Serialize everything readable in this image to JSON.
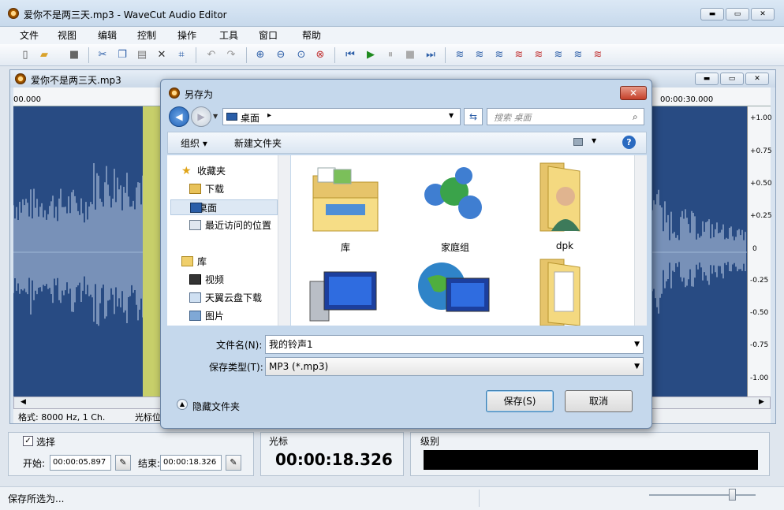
{
  "app": {
    "title": "爱你不是两三天.mp3 - WaveCut Audio Editor",
    "window_buttons": {
      "minimize": "▬",
      "maximize": "▭",
      "close": "✕"
    }
  },
  "menu": [
    "文件",
    "视图",
    "编辑",
    "控制",
    "操作",
    "工具",
    "窗口",
    "帮助"
  ],
  "toolbar": {
    "icons": [
      "new-file-icon",
      "open-folder-icon",
      "save-icon",
      "cut-icon",
      "copy-icon",
      "paste-icon",
      "delete-icon",
      "crop-icon",
      "undo-icon",
      "redo-icon",
      "zoom-in-icon",
      "zoom-out-icon",
      "zoom-selection-icon",
      "zoom-all-icon",
      "skip-start-icon",
      "play-icon",
      "pause-icon",
      "stop-icon",
      "skip-end-icon",
      "effect-1-icon",
      "effect-2-icon",
      "effect-3-icon",
      "effect-4-icon",
      "effect-5-icon",
      "effect-6-icon",
      "effect-7-icon",
      "effect-8-icon"
    ]
  },
  "document": {
    "title": "爱你不是两三天.mp3",
    "ruler": {
      "start": "00.000",
      "end": "00:00:30.000"
    },
    "y_axis": [
      "+1.00",
      "+0.75",
      "+0.50",
      "+0.25",
      "0",
      "-0.25",
      "-0.50",
      "-0.75",
      "-1.00"
    ],
    "colors": {
      "waveform_bg": "#284b83",
      "waveform": "#c7d7ee",
      "selection": "#c7cf6a"
    },
    "status": {
      "format": "格式: 8000 Hz, 1 Ch.",
      "cursor_cut": "光标位"
    }
  },
  "selection_panel": {
    "checkbox_label": "选择",
    "checked": true,
    "start_label": "开始:",
    "start_value": "00:00:05.897",
    "end_label": "结束:",
    "end_value": "00:00:18.326"
  },
  "cursor_panel": {
    "label": "光标",
    "value": "00:00:18.326"
  },
  "level_panel": {
    "label": "级别"
  },
  "statusbar": {
    "text": "保存所选为..."
  },
  "dialog": {
    "title": "另存为",
    "address": "桌面",
    "address_arrow": "▸",
    "search_placeholder": "搜索 桌面",
    "organize": "组织 ▾",
    "new_folder": "新建文件夹",
    "nav": {
      "favorites": "收藏夹",
      "downloads": "下载",
      "desktop": "桌面",
      "recent": "最近访问的位置",
      "libraries": "库",
      "videos": "视频",
      "cloud": "天翼云盘下载",
      "pictures": "图片"
    },
    "files": [
      "库",
      "家庭组",
      "dpk",
      "",
      "",
      ""
    ],
    "filename_label": "文件名(N):",
    "filename_value": "我的铃声1",
    "filetype_label": "保存类型(T):",
    "filetype_value": "MP3 (*.mp3)",
    "hide_folders": "隐藏文件夹",
    "save_button": "保存(S)",
    "cancel_button": "取消"
  }
}
